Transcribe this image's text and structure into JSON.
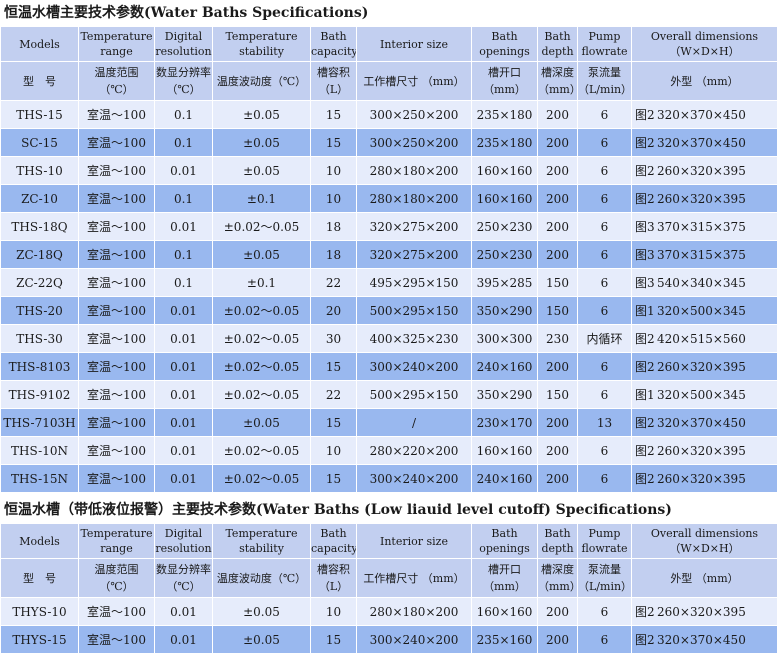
{
  "table1": {
    "title": "恒温水槽主要技术参数(Water Baths Specifications)",
    "header_en": [
      "Models",
      "Temperature range",
      "Digital resolution",
      "Temperature stability",
      "Bath capacity",
      "Interior size",
      "Bath openings",
      "Bath depth",
      "Pump flowrate",
      "Overall dimensions （W×D×H）"
    ],
    "header_zh": [
      "型　号",
      "温度范围 （℃）",
      "数显分辨率（℃）",
      "温度波动度（℃）",
      "槽容积（L）",
      "工作槽尺寸 （mm）",
      "槽开口 （mm）",
      "槽深度（mm）",
      "泵流量（L/min）",
      "外型 （mm）"
    ],
    "rows": [
      {
        "model": "THS-15",
        "range": "室温～100",
        "res": "0.1",
        "stab": "±0.05",
        "cap": "15",
        "interior": "300×250×200",
        "open": "235×180",
        "depth": "200",
        "pump": "6",
        "fig": "图2",
        "dims": "320×370×450"
      },
      {
        "model": "SC-15",
        "range": "室温～100",
        "res": "0.1",
        "stab": "±0.05",
        "cap": "15",
        "interior": "300×250×200",
        "open": "235×180",
        "depth": "200",
        "pump": "6",
        "fig": "图2",
        "dims": "320×370×450"
      },
      {
        "model": "THS-10",
        "range": "室温～100",
        "res": "0.01",
        "stab": "±0.05",
        "cap": "10",
        "interior": "280×180×200",
        "open": "160×160",
        "depth": "200",
        "pump": "6",
        "fig": "图2",
        "dims": "260×320×395"
      },
      {
        "model": "ZC-10",
        "range": "室温～100",
        "res": "0.1",
        "stab": "±0.1",
        "cap": "10",
        "interior": "280×180×200",
        "open": "160×160",
        "depth": "200",
        "pump": "6",
        "fig": "图2",
        "dims": "260×320×395"
      },
      {
        "model": "THS-18Q",
        "range": "室温～100",
        "res": "0.01",
        "stab": "±0.02～0.05",
        "cap": "18",
        "interior": "320×275×200",
        "open": "250×230",
        "depth": "200",
        "pump": "6",
        "fig": "图3",
        "dims": "370×315×375"
      },
      {
        "model": "ZC-18Q",
        "range": "室温～100",
        "res": "0.1",
        "stab": "±0.05",
        "cap": "18",
        "interior": "320×275×200",
        "open": "250×230",
        "depth": "200",
        "pump": "6",
        "fig": "图3",
        "dims": "370×315×375"
      },
      {
        "model": "ZC-22Q",
        "range": "室温～100",
        "res": "0.1",
        "stab": "±0.1",
        "cap": "22",
        "interior": "495×295×150",
        "open": "395×285",
        "depth": "150",
        "pump": "6",
        "fig": "图3",
        "dims": "540×340×345"
      },
      {
        "model": "THS-20",
        "range": "室温～100",
        "res": "0.01",
        "stab": "±0.02～0.05",
        "cap": "20",
        "interior": "500×295×150",
        "open": "350×290",
        "depth": "150",
        "pump": "6",
        "fig": "图1",
        "dims": "320×500×345"
      },
      {
        "model": "THS-30",
        "range": "室温～100",
        "res": "0.01",
        "stab": "±0.02～0.05",
        "cap": "30",
        "interior": "400×325×230",
        "open": "300×300",
        "depth": "230",
        "pump": "内循环",
        "fig": "图2",
        "dims": "420×515×560"
      },
      {
        "model": "THS-8103",
        "range": "室温～100",
        "res": "0.01",
        "stab": "±0.02～0.05",
        "cap": "15",
        "interior": "300×240×200",
        "open": "240×160",
        "depth": "200",
        "pump": "6",
        "fig": "图2",
        "dims": "260×320×395"
      },
      {
        "model": "THS-9102",
        "range": "室温～100",
        "res": "0.01",
        "stab": "±0.02～0.05",
        "cap": "22",
        "interior": "500×295×150",
        "open": "350×290",
        "depth": "150",
        "pump": "6",
        "fig": "图1",
        "dims": "320×500×345"
      },
      {
        "model": "THS-7103H",
        "range": "室温～100",
        "res": "0.01",
        "stab": "±0.05",
        "cap": "15",
        "interior": "/",
        "open": "230×170",
        "depth": "200",
        "pump": "13",
        "fig": "图2",
        "dims": "320×370×450"
      },
      {
        "model": "THS-10N",
        "range": "室温～100",
        "res": "0.01",
        "stab": "±0.02～0.05",
        "cap": "10",
        "interior": "280×220×200",
        "open": "160×160",
        "depth": "200",
        "pump": "6",
        "fig": "图2",
        "dims": "260×320×395"
      },
      {
        "model": "THS-15N",
        "range": "室温～100",
        "res": "0.01",
        "stab": "±0.02～0.05",
        "cap": "15",
        "interior": "300×240×200",
        "open": "240×160",
        "depth": "200",
        "pump": "6",
        "fig": "图2",
        "dims": "260×320×395"
      }
    ]
  },
  "table2": {
    "title": "恒温水槽（带低液位报警）主要技术参数(Water Baths (Low liauid level cutoff) Specifications)",
    "header_en": [
      "Models",
      "Temperature range",
      "Digital resolution",
      "Temperature stability",
      "Bath capacity",
      "Interior size",
      "Bath openings",
      "Bath depth",
      "Pump flowrate",
      "Overall dimensions （W×D×H）"
    ],
    "header_zh": [
      "型　号",
      "温度范围 （℃）",
      "数显分辨率（℃）",
      "温度波动度（℃）",
      "槽容积（L）",
      "工作槽尺寸 （mm）",
      "槽开口 （mm）",
      "槽深度（mm）",
      "泵流量（L/min）",
      "外型 （mm）"
    ],
    "rows": [
      {
        "model": "THYS-10",
        "range": "室温～100",
        "res": "0.01",
        "stab": "±0.05",
        "cap": "10",
        "interior": "280×180×200",
        "open": "160×160",
        "depth": "200",
        "pump": "6",
        "fig": "图2",
        "dims": "260×320×395"
      },
      {
        "model": "THYS-15",
        "range": "室温～100",
        "res": "0.01",
        "stab": "±0.05",
        "cap": "15",
        "interior": "300×240×200",
        "open": "235×160",
        "depth": "200",
        "pump": "6",
        "fig": "图2",
        "dims": "320×370×450"
      }
    ]
  },
  "colors": {
    "header": "#c2cff0",
    "row_light": "#e6ecfb",
    "row_dark": "#99b8ef"
  }
}
